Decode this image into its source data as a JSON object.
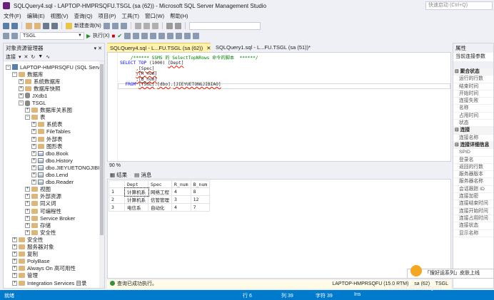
{
  "window": {
    "title": "SQLQuery4.sql - LAPTOP-HMPRSQFU.TSGL (sa (62)) - Microsoft SQL Server Management Studio",
    "quick_launch": "快速启动 (Ctrl+Q)"
  },
  "menu": [
    "文件(F)",
    "编辑(E)",
    "视图(V)",
    "查询(Q)",
    "项目(P)",
    "工具(T)",
    "窗口(W)",
    "帮助(H)"
  ],
  "toolbar": {
    "new_query": "新建查询(N)",
    "database": "TSGL",
    "execute": "执行(X)"
  },
  "object_explorer": {
    "title": "对象资源管理器",
    "connect": "连接",
    "nodes": [
      {
        "label": "LAPTOP-HMPRSQFU (SQL Server",
        "depth": 0,
        "exp": "−",
        "icon": "server-icon"
      },
      {
        "label": "数据库",
        "depth": 1,
        "exp": "−",
        "icon": "folder-icon"
      },
      {
        "label": "系统数据库",
        "depth": 2,
        "exp": "+",
        "icon": "folder-icon"
      },
      {
        "label": "数据库快照",
        "depth": 2,
        "exp": "+",
        "icon": "folder-icon"
      },
      {
        "label": "JXdb1",
        "depth": 2,
        "exp": "+",
        "icon": "database-icon"
      },
      {
        "label": "TSGL",
        "depth": 2,
        "exp": "−",
        "icon": "database-icon"
      },
      {
        "label": "数据库关系图",
        "depth": 3,
        "exp": "+",
        "icon": "folder-icon"
      },
      {
        "label": "表",
        "depth": 3,
        "exp": "−",
        "icon": "folder-icon"
      },
      {
        "label": "系统表",
        "depth": 4,
        "exp": "+",
        "icon": "folder-icon"
      },
      {
        "label": "FileTables",
        "depth": 4,
        "exp": "+",
        "icon": "folder-icon"
      },
      {
        "label": "外部表",
        "depth": 4,
        "exp": "+",
        "icon": "folder-icon"
      },
      {
        "label": "图形表",
        "depth": 4,
        "exp": "+",
        "icon": "folder-icon"
      },
      {
        "label": "dbo.Book",
        "depth": 4,
        "exp": "+",
        "icon": "table-icon"
      },
      {
        "label": "dbo.History",
        "depth": 4,
        "exp": "+",
        "icon": "table-icon"
      },
      {
        "label": "dbo.JIEYUETONGJIBIAO",
        "depth": 4,
        "exp": "+",
        "icon": "table-icon"
      },
      {
        "label": "dbo.Lend",
        "depth": 4,
        "exp": "+",
        "icon": "table-icon"
      },
      {
        "label": "dbo.Reader",
        "depth": 4,
        "exp": "+",
        "icon": "table-icon"
      },
      {
        "label": "视图",
        "depth": 3,
        "exp": "+",
        "icon": "folder-icon"
      },
      {
        "label": "外部资源",
        "depth": 3,
        "exp": "+",
        "icon": "folder-icon"
      },
      {
        "label": "同义词",
        "depth": 3,
        "exp": "+",
        "icon": "folder-icon"
      },
      {
        "label": "可编程性",
        "depth": 3,
        "exp": "+",
        "icon": "folder-icon"
      },
      {
        "label": "Service Broker",
        "depth": 3,
        "exp": "+",
        "icon": "folder-icon"
      },
      {
        "label": "存储",
        "depth": 3,
        "exp": "+",
        "icon": "folder-icon"
      },
      {
        "label": "安全性",
        "depth": 3,
        "exp": "+",
        "icon": "folder-icon"
      },
      {
        "label": "安全性",
        "depth": 1,
        "exp": "+",
        "icon": "folder-icon"
      },
      {
        "label": "服务器对象",
        "depth": 1,
        "exp": "+",
        "icon": "folder-icon"
      },
      {
        "label": "复制",
        "depth": 1,
        "exp": "+",
        "icon": "folder-icon"
      },
      {
        "label": "PolyBase",
        "depth": 1,
        "exp": "+",
        "icon": "folder-icon"
      },
      {
        "label": "Always On 高可用性",
        "depth": 1,
        "exp": "+",
        "icon": "folder-icon"
      },
      {
        "label": "管理",
        "depth": 1,
        "exp": "+",
        "icon": "folder-icon"
      },
      {
        "label": "Integration Services 目录",
        "depth": 1,
        "exp": "+",
        "icon": "folder-icon"
      }
    ]
  },
  "tabs": {
    "active": "SQLQuery4.sql - L...FU.TSGL (sa (62))",
    "inactive": "SQLQuery1.sql - L...FU.TSGL (sa (51))*"
  },
  "editor": {
    "lines": [
      [
        {
          "t": "    /****** SSMS 的 SelectTopNRows 命令的脚本  ******/",
          "c": "cm"
        }
      ],
      [
        {
          "t": "SELECT TOP ",
          "c": "kw"
        },
        {
          "t": "(1000)",
          "c": "id"
        },
        {
          "t": " ",
          "c": "id"
        },
        {
          "t": "[Dept]",
          "c": "id sq"
        }
      ],
      [
        {
          "t": "      ",
          "c": "id"
        },
        {
          "t": ",[Spec]",
          "c": "id sq"
        }
      ],
      [
        {
          "t": "      ",
          "c": "id"
        },
        {
          "t": ",[R_num]",
          "c": "id sq"
        }
      ],
      [
        {
          "t": "      ",
          "c": "id"
        },
        {
          "t": ",[B_num]",
          "c": "id sq"
        }
      ],
      [
        {
          "t": "  FROM ",
          "c": "kw"
        },
        {
          "t": "[TSGL]",
          "c": "id sq"
        },
        {
          "t": ".",
          "c": "id"
        },
        {
          "t": "[dbo]",
          "c": "id sq"
        },
        {
          "t": ".",
          "c": "id"
        },
        {
          "t": "[JIEYUETONGJIBIAO]",
          "c": "id sq"
        }
      ]
    ],
    "zoom": "90 %"
  },
  "results": {
    "tab_results": "结果",
    "tab_messages": "消息",
    "columns": [
      "Dept",
      "Spec",
      "R_num",
      "B_num"
    ],
    "rows": [
      [
        "1",
        "计算机系",
        "网络工程",
        "4",
        "8"
      ],
      [
        "2",
        "计算机系",
        "信管管理",
        "3",
        "12"
      ],
      [
        "3",
        "电信系",
        "自动化",
        "4",
        "7"
      ]
    ]
  },
  "query_status": {
    "message": "查询已成功执行。",
    "server": "LAPTOP-HMPRSQFU (15.0 RTM)",
    "user": "sa (62)",
    "db": "TSGL"
  },
  "properties": {
    "title": "属性",
    "subtitle": "当前连接参数",
    "rows": [
      {
        "label": "聚合状态",
        "cat": true
      },
      {
        "label": "运行的行数",
        "cat": false
      },
      {
        "label": "结束时间",
        "cat": false
      },
      {
        "label": "开始时间",
        "cat": false
      },
      {
        "label": "连接失败",
        "cat": false
      },
      {
        "label": "名称",
        "cat": false
      },
      {
        "label": "占用时间",
        "cat": false
      },
      {
        "label": "状态",
        "cat": false
      },
      {
        "label": "连接",
        "cat": true
      },
      {
        "label": "连接名称",
        "cat": false
      },
      {
        "label": "连接详细信息",
        "cat": true
      },
      {
        "label": "SPID",
        "cat": false
      },
      {
        "label": "登录名",
        "cat": false
      },
      {
        "label": "返回的行数",
        "cat": false
      },
      {
        "label": "服务器版本",
        "cat": false
      },
      {
        "label": "服务器名称",
        "cat": false
      },
      {
        "label": "会话跟踪 ID",
        "cat": false
      },
      {
        "label": "连接加密",
        "cat": false
      },
      {
        "label": "连接结束时间",
        "cat": false
      },
      {
        "label": "连接开始时间",
        "cat": false
      },
      {
        "label": "连接占用时间",
        "cat": false
      },
      {
        "label": "连接状态",
        "cat": false
      },
      {
        "label": "显示名称",
        "cat": false
      }
    ]
  },
  "statusbar": {
    "ready": "就绪",
    "line": "行 6",
    "col": "列 39",
    "ch": "字符 39",
    "mode": "Ins"
  },
  "notification": "「搜好运系列」皮肤上线",
  "watermark": "CSDN @Uoforyou",
  "colors": {
    "accent": "#007acc",
    "active_tab": "#fff2ab",
    "keyword": "#0000ff",
    "comment": "#008000"
  }
}
